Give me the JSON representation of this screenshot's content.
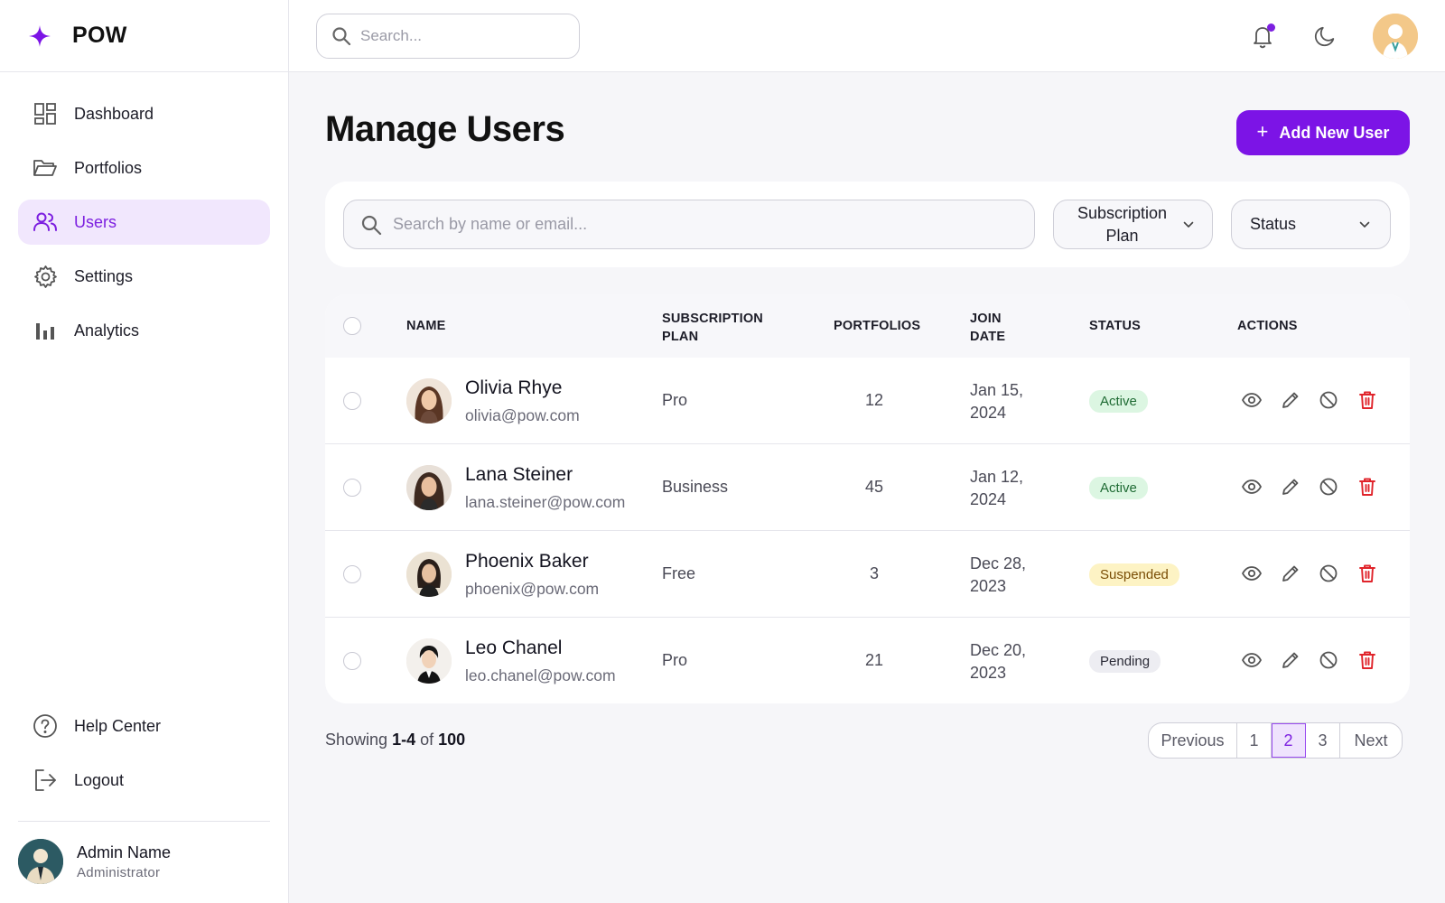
{
  "brand": {
    "name": "POW"
  },
  "sidebar": {
    "items": [
      {
        "label": "Dashboard",
        "icon": "dashboard-icon"
      },
      {
        "label": "Portfolios",
        "icon": "folder-icon"
      },
      {
        "label": "Users",
        "icon": "users-icon",
        "active": true
      },
      {
        "label": "Settings",
        "icon": "gear-icon"
      },
      {
        "label": "Analytics",
        "icon": "bar-chart-icon"
      }
    ],
    "bottom_items": [
      {
        "label": "Help Center",
        "icon": "help-icon"
      },
      {
        "label": "Logout",
        "icon": "logout-icon"
      }
    ],
    "admin": {
      "name": "Admin Name",
      "role": "Administrator"
    }
  },
  "topbar": {
    "search_placeholder": "Search...",
    "notification_dot": true
  },
  "page": {
    "title": "Manage Users",
    "add_button_label": "Add New User"
  },
  "filters": {
    "search_placeholder": "Search by name or email...",
    "plan_label": "Subscription Plan",
    "status_label": "Status"
  },
  "table": {
    "headers": {
      "name": "NAME",
      "plan": "SUBSCRIPTION PLAN",
      "portfolios": "PORTFOLIOS",
      "join_date": "JOIN DATE",
      "status": "STATUS",
      "actions": "ACTIONS"
    },
    "rows": [
      {
        "name": "Olivia Rhye",
        "email": "olivia@pow.com",
        "plan": "Pro",
        "portfolios": "12",
        "date_line1": "Jan 15,",
        "date_line2": "2024",
        "status": "Active",
        "status_kind": "active"
      },
      {
        "name": "Lana Steiner",
        "email": "lana.steiner@pow.com",
        "plan": "Business",
        "portfolios": "45",
        "date_line1": "Jan 12,",
        "date_line2": "2024",
        "status": "Active",
        "status_kind": "active"
      },
      {
        "name": "Phoenix Baker",
        "email": "phoenix@pow.com",
        "plan": "Free",
        "portfolios": "3",
        "date_line1": "Dec 28,",
        "date_line2": "2023",
        "status": "Suspended",
        "status_kind": "suspended"
      },
      {
        "name": "Leo Chanel",
        "email": "leo.chanel@pow.com",
        "plan": "Pro",
        "portfolios": "21",
        "date_line1": "Dec 20,",
        "date_line2": "2023",
        "status": "Pending",
        "status_kind": "pending"
      }
    ]
  },
  "pagination": {
    "showing_prefix": "Showing",
    "range": "1-4",
    "of_label": "of",
    "total": "100",
    "previous_label": "Previous",
    "next_label": "Next",
    "pages": [
      "1",
      "2",
      "3"
    ],
    "current_page": "2"
  },
  "colors": {
    "accent": "#7c14e6",
    "active_nav_bg": "#f1e7fd",
    "delete_red": "#e0242b",
    "badge_active_bg": "#dcf6e2",
    "badge_suspended_bg": "#fdf3c4",
    "badge_pending_bg": "#ededf2"
  }
}
